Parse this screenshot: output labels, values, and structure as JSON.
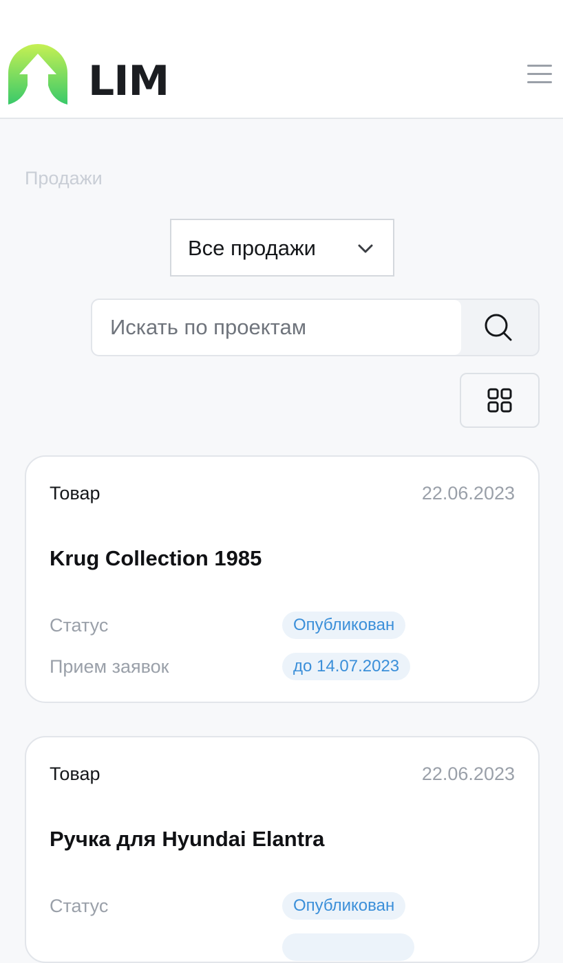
{
  "header": {
    "logo_text": "LIM"
  },
  "breadcrumb": "Продажи",
  "filter": {
    "selected": "Все продажи"
  },
  "search": {
    "placeholder": "Искать по проектам"
  },
  "colors": {
    "accent": "#3b8fd9",
    "pill_background": "#ecf3fa",
    "logo_gradient_top": "#c6f053",
    "logo_gradient_bottom": "#39c96a"
  },
  "icons": {
    "menu": "hamburger-icon",
    "chevron": "chevron-down-icon",
    "search": "search-icon",
    "view": "grid-view-icon"
  },
  "cards": [
    {
      "type": "Товар",
      "date": "22.06.2023",
      "title": "Krug Collection 1985",
      "status_label": "Статус",
      "status_value": "Опубликован",
      "deadline_label": "Прием заявок",
      "deadline_value": "до 14.07.2023"
    },
    {
      "type": "Товар",
      "date": "22.06.2023",
      "title": "Ручка для Hyundai Elantra",
      "status_label": "Статус",
      "status_value": "Опубликован"
    }
  ]
}
